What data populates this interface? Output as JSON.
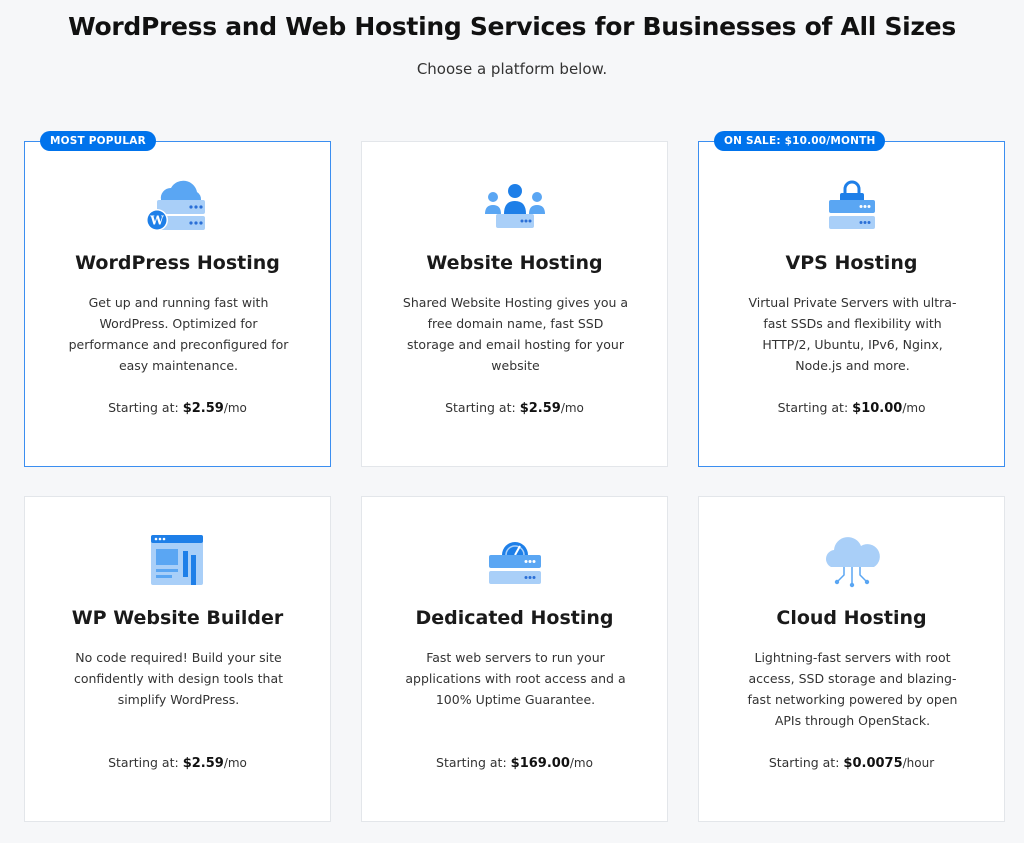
{
  "header": {
    "title": "WordPress and Web Hosting Services for Businesses of All Sizes",
    "subtitle": "Choose a platform below."
  },
  "colors": {
    "accent": "#0073ec",
    "icon_light": "#a9cff8",
    "icon_mid": "#5aa6f3"
  },
  "cards": [
    {
      "badge": "MOST POPULAR",
      "icon": "wordpress-server-icon",
      "title": "WordPress Hosting",
      "description": "Get up and running fast with WordPress. Optimized for performance and preconfigured for easy maintenance.",
      "price_label": "Starting at:",
      "price": "$2.59",
      "unit": "/mo"
    },
    {
      "badge": "",
      "icon": "team-server-icon",
      "title": "Website Hosting",
      "description": "Shared Website Hosting gives you a free domain name, fast SSD storage and email hosting for your website",
      "price_label": "Starting at:",
      "price": "$2.59",
      "unit": "/mo"
    },
    {
      "badge": "ON SALE: $10.00/MONTH",
      "icon": "locked-server-icon",
      "title": "VPS Hosting",
      "description": "Virtual Private Servers with ultra-fast SSDs and flexibility with HTTP/2, Ubuntu, IPv6, Nginx, Node.js and more.",
      "price_label": "Starting at:",
      "price": "$10.00",
      "unit": "/mo"
    },
    {
      "badge": "",
      "icon": "site-builder-icon",
      "title": "WP Website Builder",
      "description": "No code required! Build your site confidently with design tools that simplify WordPress.",
      "price_label": "Starting at:",
      "price": "$2.59",
      "unit": "/mo"
    },
    {
      "badge": "",
      "icon": "dedicated-server-gauge-icon",
      "title": "Dedicated Hosting",
      "description": "Fast web servers to run your applications with root access and a 100% Uptime Guarantee.",
      "price_label": "Starting at:",
      "price": "$169.00",
      "unit": "/mo"
    },
    {
      "badge": "",
      "icon": "cloud-network-icon",
      "title": "Cloud Hosting",
      "description": "Lightning-fast servers with root access, SSD storage and blazing-fast networking powered by open APIs through OpenStack.",
      "price_label": "Starting at:",
      "price": "$0.0075",
      "unit": "/hour"
    }
  ]
}
